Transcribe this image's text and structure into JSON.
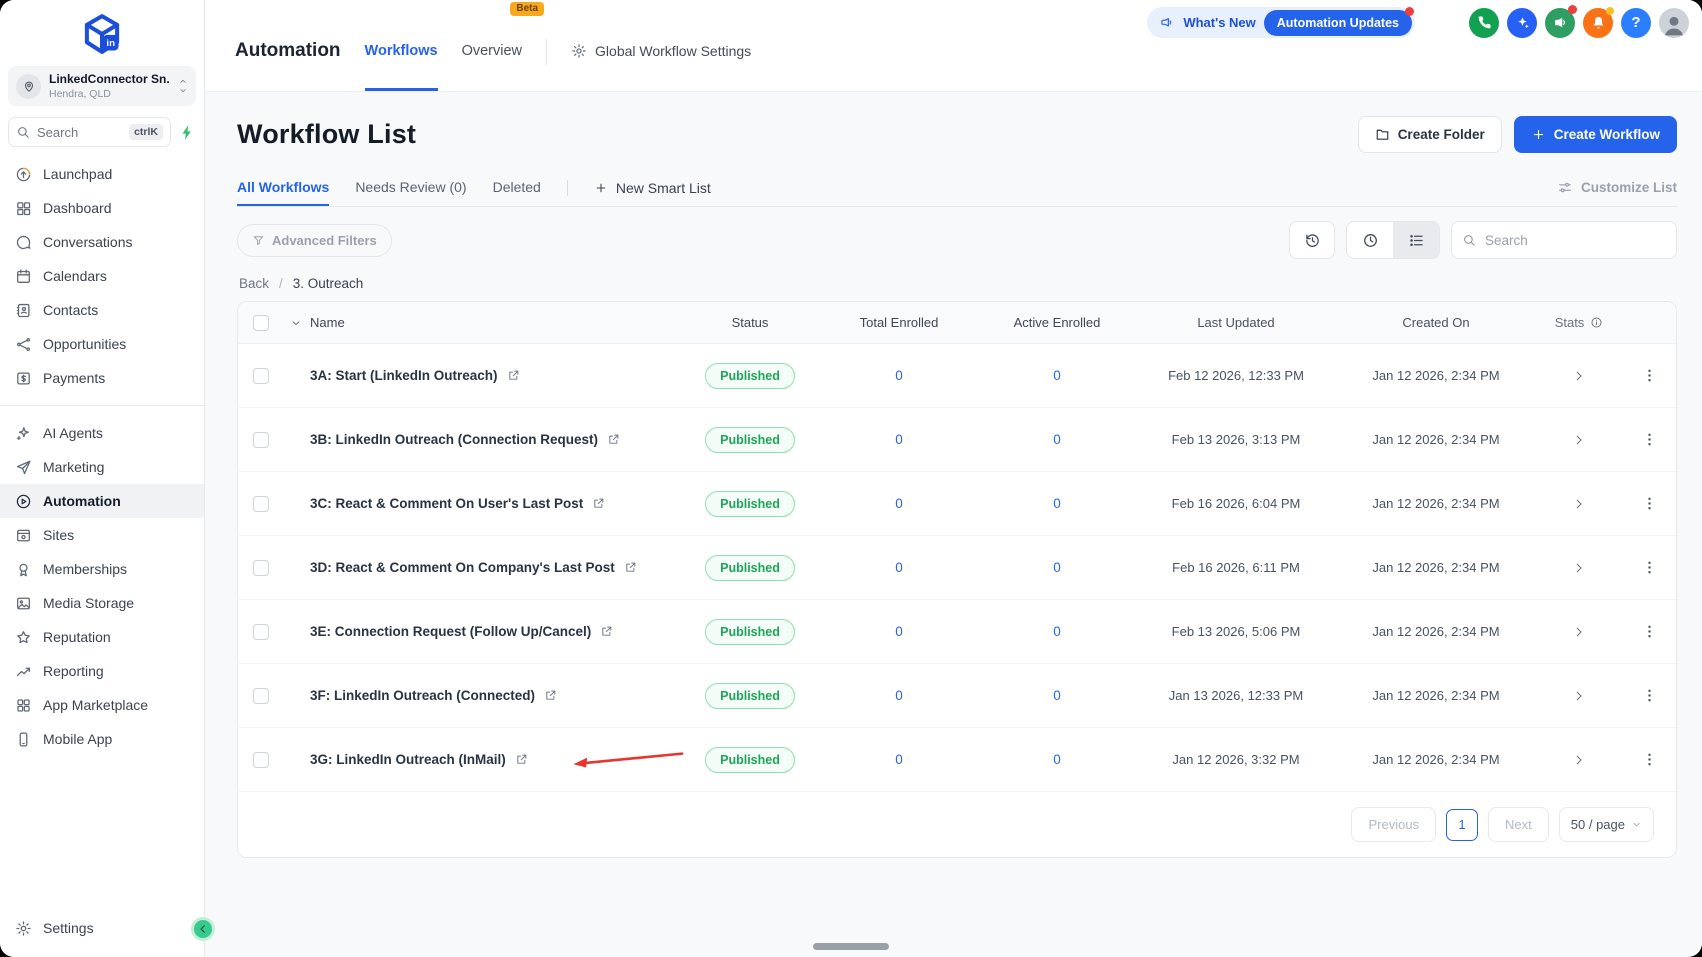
{
  "colors": {
    "accent": "#2563eb",
    "link": "#2563eb",
    "arrow": "#e8352e",
    "beta": "#f8a81c",
    "pubText": "#1fa45b",
    "pubBorder": "#8ce0b0",
    "pubBg": "#f4fcf7",
    "phone": "#12a150",
    "ai": "#2760f5",
    "mega": "#2f9e63",
    "bell": "#f97316",
    "help": "#2b7fff"
  },
  "sidebar": {
    "logo_badge": "in",
    "account": {
      "name": "LinkedConnector Sn...",
      "location": "Hendra, QLD"
    },
    "search": {
      "placeholder": "Search",
      "shortcut": "ctrlK"
    },
    "menu_primary": [
      {
        "label": "Launchpad",
        "icon": "launchpad-icon"
      },
      {
        "label": "Dashboard",
        "icon": "dashboard-icon"
      },
      {
        "label": "Conversations",
        "icon": "conversations-icon"
      },
      {
        "label": "Calendars",
        "icon": "calendars-icon"
      },
      {
        "label": "Contacts",
        "icon": "contacts-icon"
      },
      {
        "label": "Opportunities",
        "icon": "opportunities-icon"
      },
      {
        "label": "Payments",
        "icon": "payments-icon"
      }
    ],
    "menu_secondary": [
      {
        "label": "AI Agents",
        "icon": "ai-agents-icon"
      },
      {
        "label": "Marketing",
        "icon": "marketing-icon"
      },
      {
        "label": "Automation",
        "icon": "automation-icon",
        "active": true
      },
      {
        "label": "Sites",
        "icon": "sites-icon"
      },
      {
        "label": "Memberships",
        "icon": "memberships-icon"
      },
      {
        "label": "Media Storage",
        "icon": "media-storage-icon"
      },
      {
        "label": "Reputation",
        "icon": "reputation-icon"
      },
      {
        "label": "Reporting",
        "icon": "reporting-icon"
      },
      {
        "label": "App Marketplace",
        "icon": "app-marketplace-icon"
      },
      {
        "label": "Mobile App",
        "icon": "mobile-app-icon"
      }
    ],
    "settings_label": "Settings"
  },
  "topbar": {
    "section_title": "Automation",
    "tabs": [
      {
        "label": "Workflows",
        "active": true
      },
      {
        "label": "Overview",
        "badge": "Beta"
      }
    ],
    "global_settings": "Global Workflow Settings",
    "whats_new": "What's New",
    "automation_updates": "Automation Updates"
  },
  "page": {
    "title": "Workflow List",
    "create_folder": "Create Folder",
    "create_workflow": "Create Workflow",
    "tabs": [
      {
        "label": "All Workflows",
        "active": true
      },
      {
        "label": "Needs Review (0)"
      },
      {
        "label": "Deleted"
      }
    ],
    "new_smart_list": "New Smart List",
    "customize_list": "Customize List",
    "advanced_filters": "Advanced Filters",
    "search_placeholder": "Search",
    "breadcrumb": {
      "back": "Back",
      "separator": "/",
      "current": "3. Outreach"
    }
  },
  "table": {
    "headers": [
      "Name",
      "Status",
      "Total Enrolled",
      "Active Enrolled",
      "Last Updated",
      "Created On",
      "Stats"
    ],
    "rows": [
      {
        "name": "3A: Start (LinkedIn Outreach)",
        "status": "Published",
        "total_enrolled": "0",
        "active_enrolled": "0",
        "last_updated": "Feb 12 2026, 12:33 PM",
        "created_on": "Jan 12 2026, 2:34 PM"
      },
      {
        "name": "3B: LinkedIn Outreach (Connection Request)",
        "status": "Published",
        "total_enrolled": "0",
        "active_enrolled": "0",
        "last_updated": "Feb 13 2026, 3:13 PM",
        "created_on": "Jan 12 2026, 2:34 PM"
      },
      {
        "name": "3C: React & Comment On User's Last Post",
        "status": "Published",
        "total_enrolled": "0",
        "active_enrolled": "0",
        "last_updated": "Feb 16 2026, 6:04 PM",
        "created_on": "Jan 12 2026, 2:34 PM"
      },
      {
        "name": "3D: React & Comment On Company's Last Post",
        "status": "Published",
        "total_enrolled": "0",
        "active_enrolled": "0",
        "last_updated": "Feb 16 2026, 6:11 PM",
        "created_on": "Jan 12 2026, 2:34 PM"
      },
      {
        "name": "3E: Connection Request (Follow Up/Cancel)",
        "status": "Published",
        "total_enrolled": "0",
        "active_enrolled": "0",
        "last_updated": "Feb 13 2026, 5:06 PM",
        "created_on": "Jan 12 2026, 2:34 PM"
      },
      {
        "name": "3F: LinkedIn Outreach (Connected)",
        "status": "Published",
        "total_enrolled": "0",
        "active_enrolled": "0",
        "last_updated": "Jan 13 2026, 12:33 PM",
        "created_on": "Jan 12 2026, 2:34 PM"
      },
      {
        "name": "3G: LinkedIn Outreach (InMail)",
        "status": "Published",
        "total_enrolled": "0",
        "active_enrolled": "0",
        "last_updated": "Jan 12 2026, 3:32 PM",
        "created_on": "Jan 12 2026, 2:34 PM"
      }
    ]
  },
  "annotation": {
    "type": "arrow",
    "color": "#e8352e",
    "target_row_name": "3G: LinkedIn Outreach (InMail)"
  },
  "pagination": {
    "previous": "Previous",
    "current_page": "1",
    "next": "Next",
    "page_size": "50 / page"
  }
}
